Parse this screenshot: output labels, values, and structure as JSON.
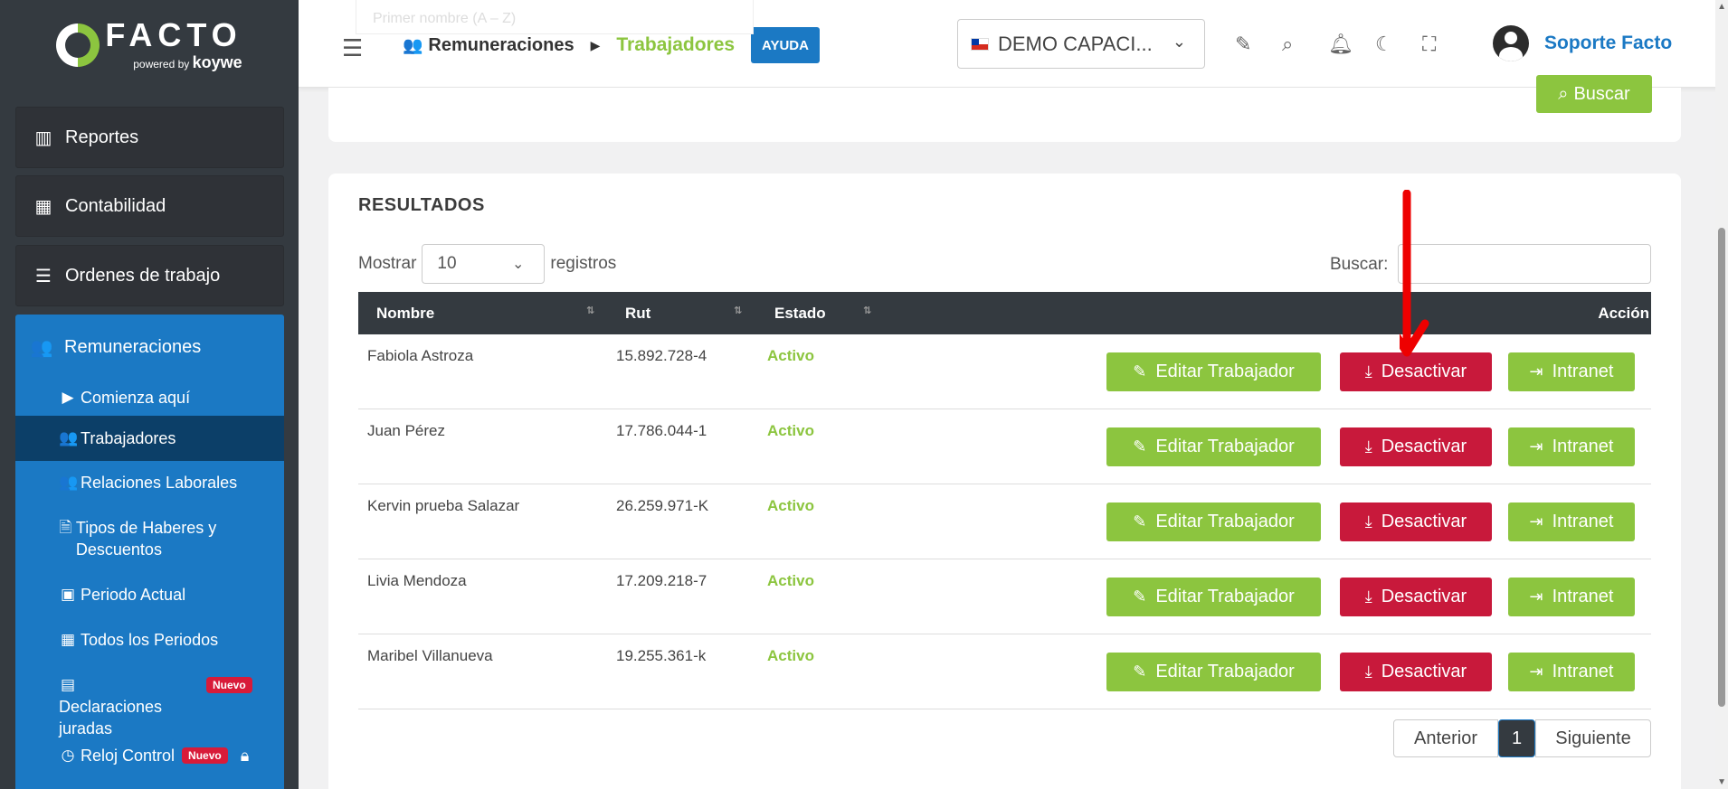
{
  "sidebar": {
    "logo_text": "FACTO",
    "logo_powered": "powered",
    "logo_by": "by",
    "logo_brand": "koywe",
    "items": [
      {
        "label": "Reportes",
        "icon": "chart-bar-icon"
      },
      {
        "label": "Contabilidad",
        "icon": "calculator-icon"
      },
      {
        "label": "Ordenes de trabajo",
        "icon": "list-check-icon"
      }
    ],
    "active_section": {
      "label": "Remuneraciones",
      "icon": "users-icon"
    },
    "sub_items": [
      {
        "label": "Comienza aquí",
        "icon": "play-icon"
      },
      {
        "label": "Trabajadores",
        "icon": "users-gear-icon"
      },
      {
        "label": "Relaciones Laborales",
        "icon": "user-group-icon"
      },
      {
        "label": "Tipos de Haberes y Descuentos",
        "icon": "file-icon"
      },
      {
        "label": "Periodo Actual",
        "icon": "calendar-icon"
      },
      {
        "label": "Todos los Periodos",
        "icon": "calendar-grid-icon"
      },
      {
        "label": "Declaraciones juradas",
        "icon": "archive-icon",
        "badge": "Nuevo"
      },
      {
        "label": "Reloj Control",
        "icon": "clock-icon",
        "badge": "Nuevo"
      }
    ]
  },
  "header": {
    "breadcrumb_1": "Remuneraciones",
    "breadcrumb_2": "Trabajadores",
    "help_label": "AYUDA",
    "company": "DEMO CAPACI...",
    "user_name": "Soporte Facto"
  },
  "filters": {
    "ghost_placeholder": "Primer nombre (A – Z)",
    "search_button": "Buscar"
  },
  "results": {
    "title": "RESULTADOS",
    "show_label": "Mostrar",
    "page_size": "10",
    "records_label": "registros",
    "search_label": "Buscar:",
    "columns": [
      "Nombre",
      "Rut",
      "Estado",
      "Acción"
    ],
    "rows": [
      {
        "nombre": "Fabiola Astroza",
        "rut": "15.892.728-4",
        "estado": "Activo"
      },
      {
        "nombre": "Juan Pérez",
        "rut": "17.786.044-1",
        "estado": "Activo"
      },
      {
        "nombre": "Kervin prueba Salazar",
        "rut": "26.259.971-K",
        "estado": "Activo"
      },
      {
        "nombre": "Livia Mendoza",
        "rut": "17.209.218-7",
        "estado": "Activo"
      },
      {
        "nombre": "Maribel Villanueva",
        "rut": "19.255.361-k",
        "estado": "Activo"
      }
    ],
    "actions": {
      "edit": "Editar Trabajador",
      "deactivate": "Desactivar",
      "intranet": "Intranet"
    },
    "pager": {
      "prev": "Anterior",
      "current": "1",
      "next": "Siguiente"
    }
  },
  "colors": {
    "brand_green": "#8cc53f",
    "brand_blue": "#1b79c4",
    "danger": "#c8193b",
    "dark": "#343a40"
  }
}
